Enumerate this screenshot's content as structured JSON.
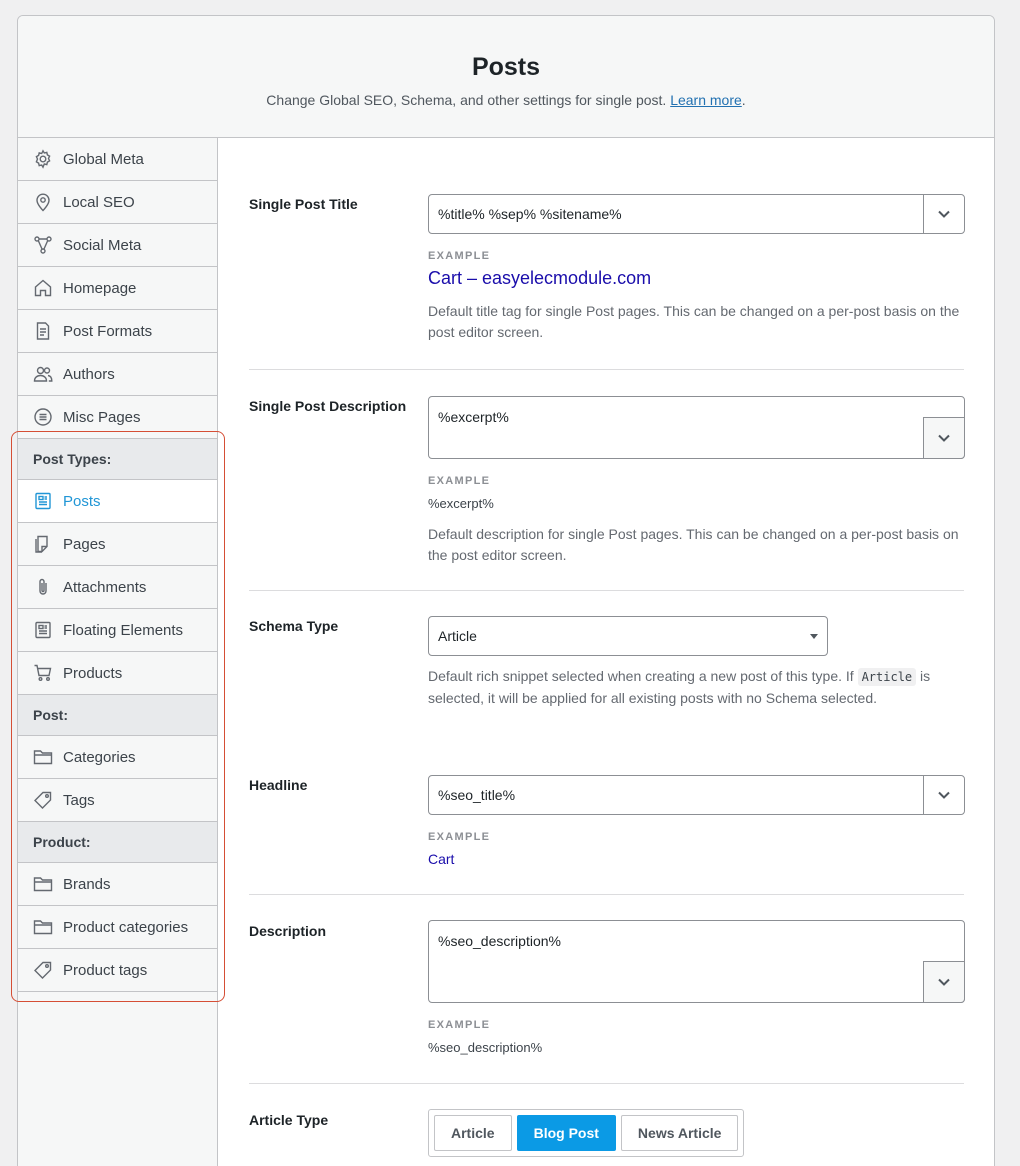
{
  "header": {
    "title": "Posts",
    "subtitle": "Change Global SEO, Schema, and other settings for single post.",
    "learn_more": "Learn more",
    "period": "."
  },
  "sidebar": {
    "items": [
      {
        "label": "Global Meta",
        "icon": "gear-icon"
      },
      {
        "label": "Local SEO",
        "icon": "location-pin-icon"
      },
      {
        "label": "Social Meta",
        "icon": "share-nodes-icon"
      },
      {
        "label": "Homepage",
        "icon": "home-icon"
      },
      {
        "label": "Post Formats",
        "icon": "document-icon"
      },
      {
        "label": "Authors",
        "icon": "users-icon"
      },
      {
        "label": "Misc Pages",
        "icon": "list-circle-icon"
      }
    ],
    "post_types_header": "Post Types:",
    "post_types": [
      {
        "label": "Posts",
        "icon": "post-icon",
        "active": true
      },
      {
        "label": "Pages",
        "icon": "page-icon"
      },
      {
        "label": "Attachments",
        "icon": "paperclip-icon"
      },
      {
        "label": "Floating Elements",
        "icon": "post-icon"
      },
      {
        "label": "Products",
        "icon": "cart-icon"
      }
    ],
    "post_header": "Post:",
    "post_taxonomies": [
      {
        "label": "Categories",
        "icon": "folder-icon"
      },
      {
        "label": "Tags",
        "icon": "tag-icon"
      }
    ],
    "product_header": "Product:",
    "product_taxonomies": [
      {
        "label": "Brands",
        "icon": "folder-icon"
      },
      {
        "label": "Product categories",
        "icon": "folder-icon"
      },
      {
        "label": "Product tags",
        "icon": "tag-icon"
      }
    ]
  },
  "fields": {
    "single_post_title": {
      "label": "Single Post Title",
      "value": "%title% %sep% %sitename%",
      "example_label": "EXAMPLE",
      "example": "Cart – easyelecmodule.com",
      "description": "Default title tag for single Post pages. This can be changed on a per-post basis on the post editor screen."
    },
    "single_post_description": {
      "label": "Single Post Description",
      "value": "%excerpt%",
      "example_label": "EXAMPLE",
      "example": "%excerpt%",
      "description": "Default description for single Post pages. This can be changed on a per-post basis on the post editor screen."
    },
    "schema_type": {
      "label": "Schema Type",
      "value": "Article",
      "description_before": "Default rich snippet selected when creating a new post of this type. If",
      "code": "Article",
      "description_after": "is selected, it will be applied for all existing posts with no Schema selected."
    },
    "headline": {
      "label": "Headline",
      "value": "%seo_title%",
      "example_label": "EXAMPLE",
      "example": "Cart"
    },
    "description": {
      "label": "Description",
      "value": "%seo_description%",
      "example_label": "EXAMPLE",
      "example": "%seo_description%"
    },
    "article_type": {
      "label": "Article Type",
      "options": [
        "Article",
        "Blog Post",
        "News Article"
      ],
      "selected": "Blog Post"
    }
  },
  "colors": {
    "accent": "#0b9ae5",
    "active_nav": "#2196d6",
    "highlight_border": "#d54e35",
    "example_link": "#1a0dab"
  }
}
